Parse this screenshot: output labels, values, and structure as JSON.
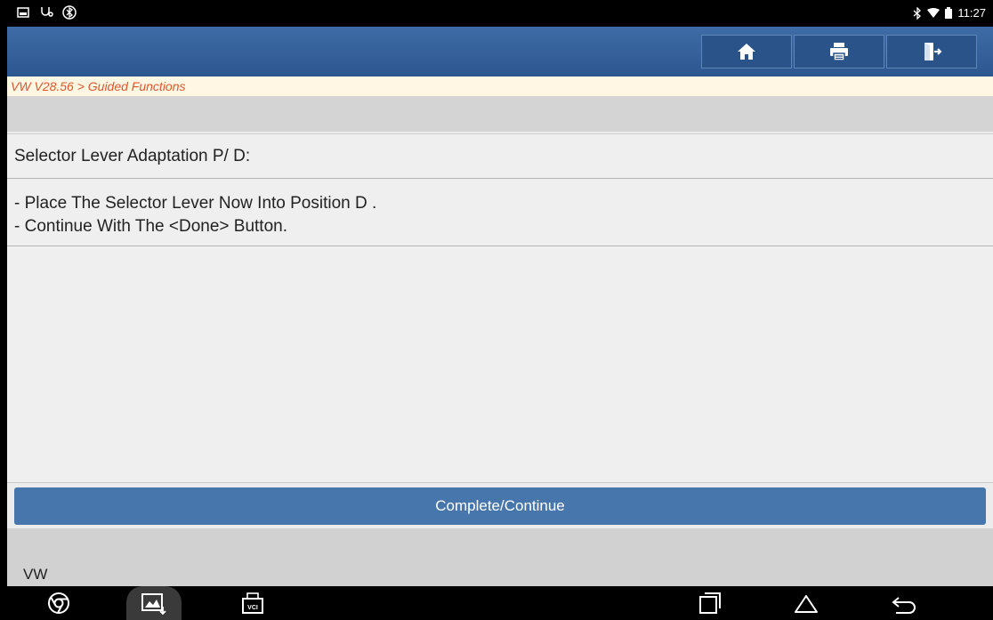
{
  "status_bar": {
    "time": "11:27"
  },
  "header": {
    "buttons": [
      {
        "name": "home",
        "icon": "home-icon"
      },
      {
        "name": "print",
        "icon": "printer-icon"
      },
      {
        "name": "exit",
        "icon": "exit-icon"
      }
    ]
  },
  "breadcrumb": "VW V28.56 > Guided Functions",
  "content": {
    "title": "Selector Lever Adaptation P/ D:",
    "instructions": [
      "- Place The Selector Lever Now Into Position D .",
      "- Continue With The <Done> Button."
    ]
  },
  "actions": {
    "complete_label": "Complete/Continue"
  },
  "footer": {
    "label": "VW"
  },
  "colors": {
    "header": "#2c5690",
    "button": "#4776ad",
    "breadcrumb_text": "#e0552a"
  },
  "nav_bar": {
    "items": [
      "chrome-icon",
      "gallery-icon",
      "vci-icon",
      "recent-apps-icon",
      "home-nav-icon",
      "back-icon"
    ],
    "vci_text": "VCI"
  }
}
